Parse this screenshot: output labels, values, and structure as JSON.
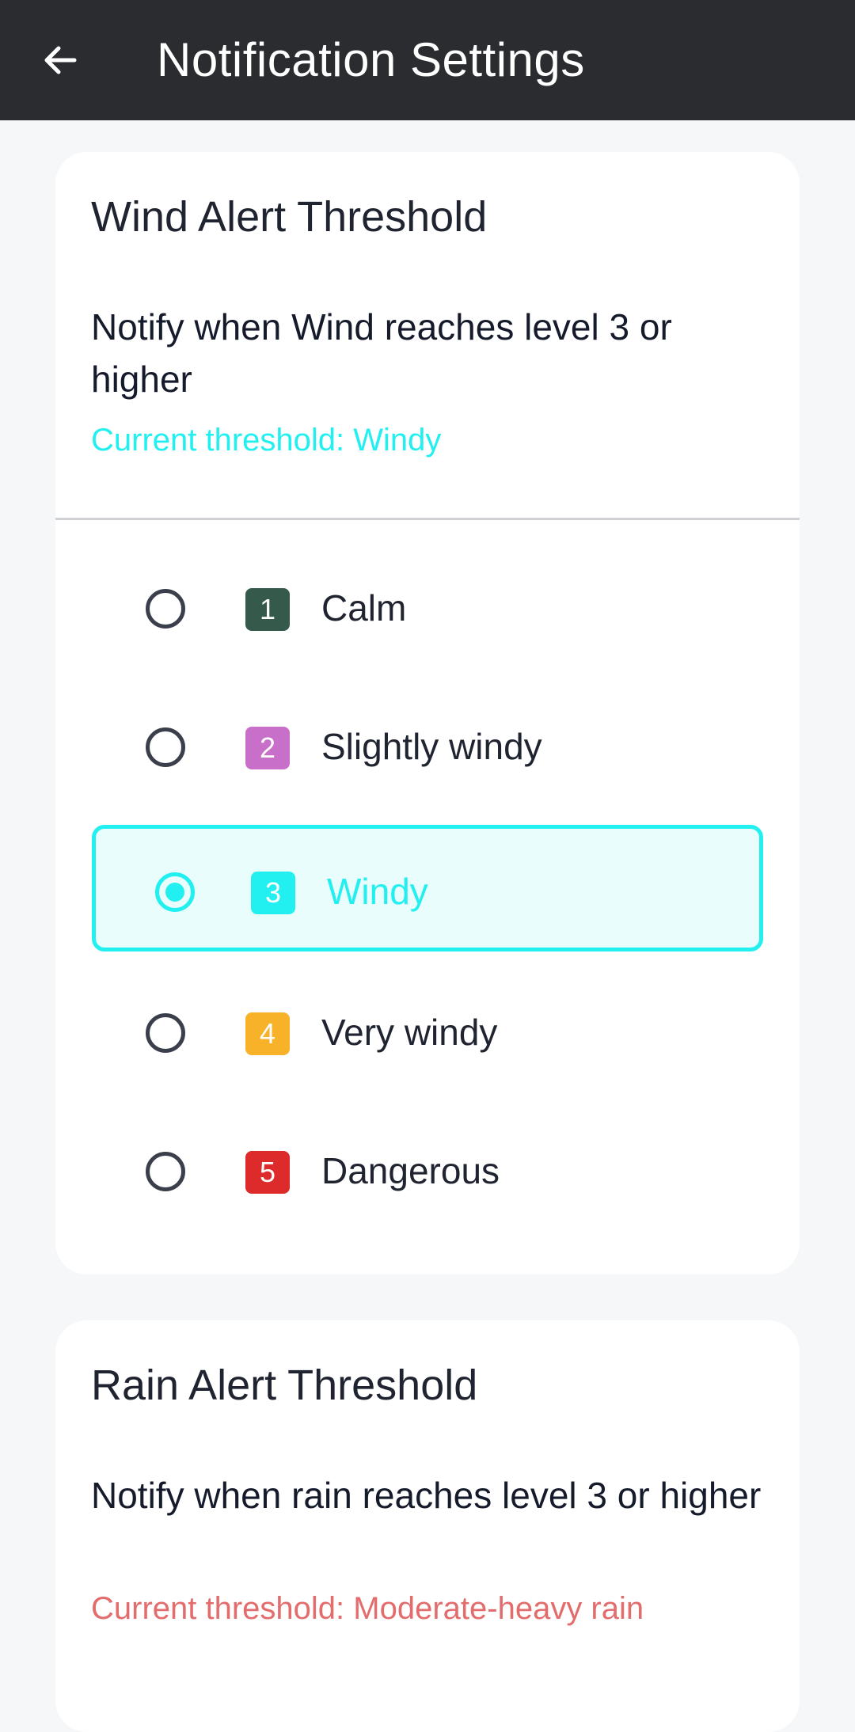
{
  "appbar": {
    "title": "Notification Settings",
    "back_icon": "arrow-left-icon"
  },
  "wind": {
    "title": "Wind Alert Threshold",
    "description": "Notify when Wind reaches level 3 or higher",
    "current_threshold": "Current threshold: Windy",
    "accent_color": "#22f0f0",
    "options": [
      {
        "level": "1",
        "label": "Calm",
        "color": "#355a4b",
        "selected": false
      },
      {
        "level": "2",
        "label": "Slightly windy",
        "color": "#c86fc9",
        "selected": false
      },
      {
        "level": "3",
        "label": "Windy",
        "color": "#22f0f0",
        "selected": true
      },
      {
        "level": "4",
        "label": "Very windy",
        "color": "#f8b22a",
        "selected": false
      },
      {
        "level": "5",
        "label": "Dangerous",
        "color": "#dd2a2a",
        "selected": false
      }
    ]
  },
  "rain": {
    "title": "Rain Alert Threshold",
    "description": "Notify when rain reaches level 3 or higher",
    "current_threshold": "Current threshold: Moderate-heavy rain",
    "accent_color": "#e36c6c"
  }
}
